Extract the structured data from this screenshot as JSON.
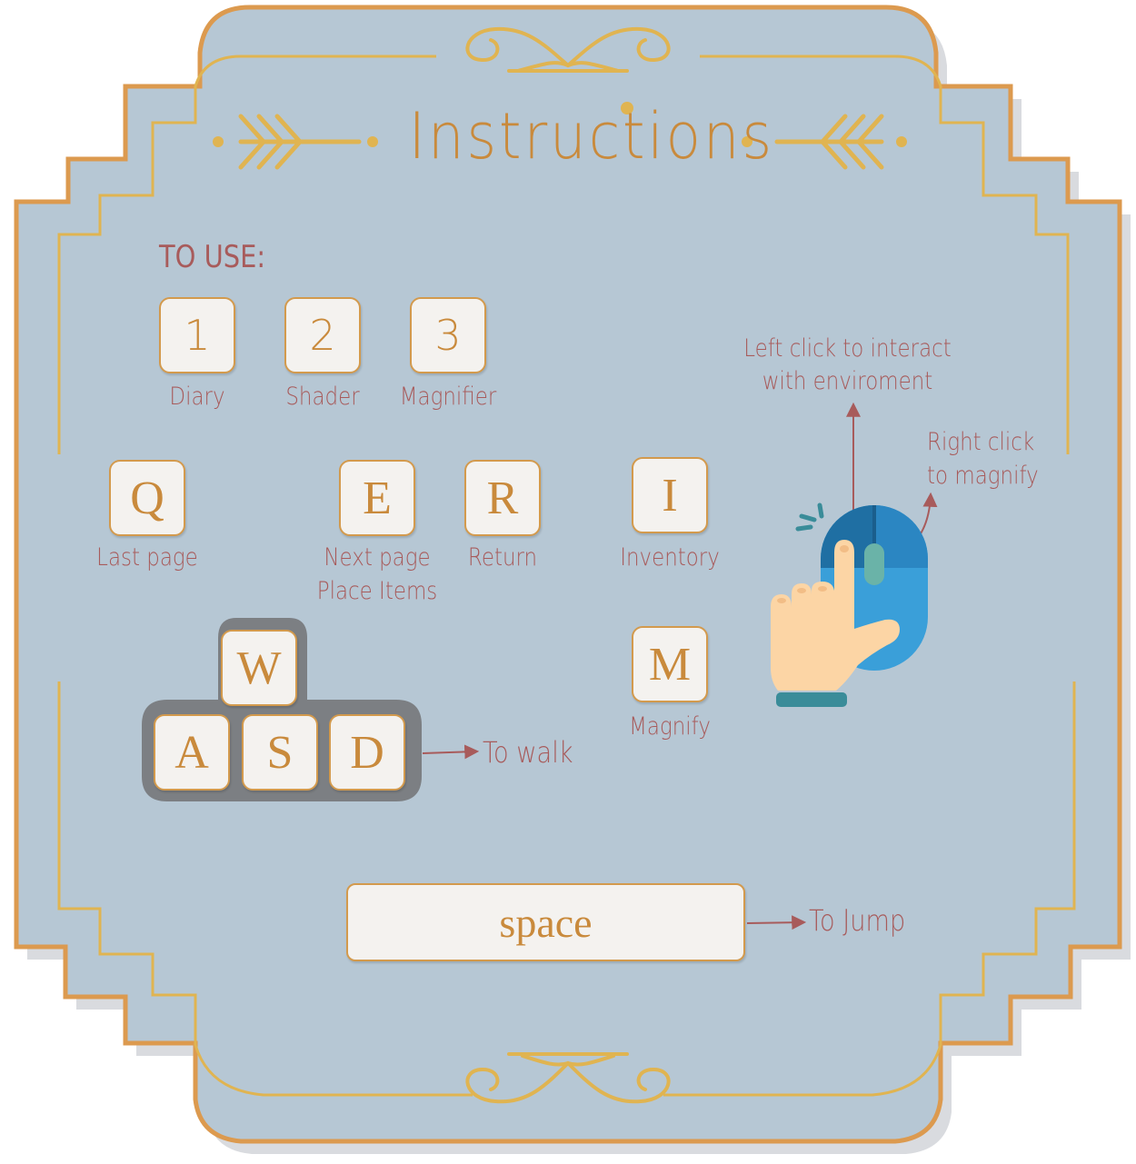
{
  "header": {
    "title": "Instructions"
  },
  "section_heading": "TO USE:",
  "number_keys": [
    {
      "key": "1",
      "label": "Diary"
    },
    {
      "key": "2",
      "label": "Shader"
    },
    {
      "key": "3",
      "label": "Magnifier"
    }
  ],
  "letter_keys": [
    {
      "key": "Q",
      "label": "Last page"
    },
    {
      "key": "E",
      "label_line1": "Next page",
      "label_line2": "Place Items"
    },
    {
      "key": "R",
      "label": "Return"
    },
    {
      "key": "I",
      "label": "Inventory"
    },
    {
      "key": "M",
      "label": "Magnify"
    }
  ],
  "wasd": {
    "keys": [
      "W",
      "A",
      "S",
      "D"
    ],
    "label": "To walk"
  },
  "space": {
    "key": "space",
    "label": "To Jump"
  },
  "mouse": {
    "left_click_line1": "Left click to interact",
    "left_click_line2": "with enviroment",
    "right_click_line1": "Right click",
    "right_click_line2": "to magnify"
  },
  "colors": {
    "panel": "#b6c7d4",
    "border": "#dc9a4f",
    "ornament": "#e0b451",
    "text": "#a85b5b",
    "key_text": "#c98a3c"
  }
}
